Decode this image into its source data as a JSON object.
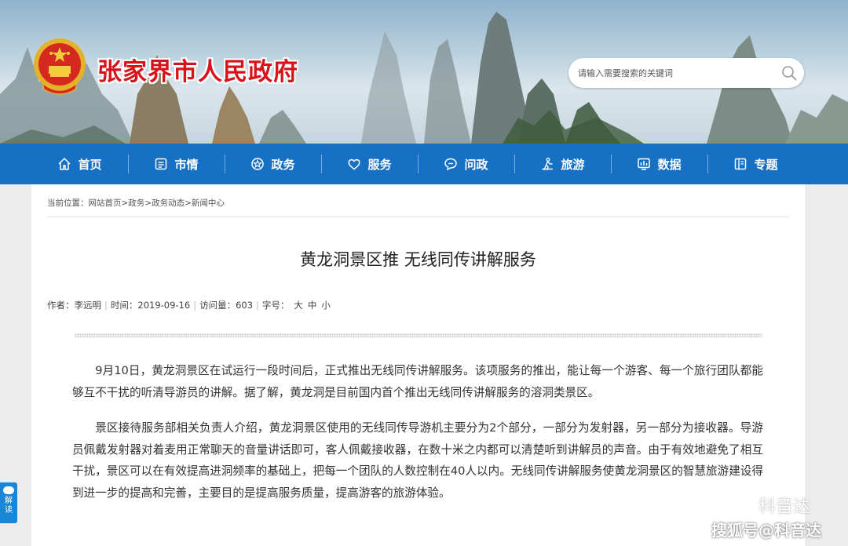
{
  "header": {
    "site_title": "张家界市人民政府",
    "search_placeholder": "请输入需要搜索的关键词"
  },
  "nav": {
    "items": [
      {
        "label": "首页",
        "icon": "home-icon"
      },
      {
        "label": "市情",
        "icon": "document-icon"
      },
      {
        "label": "政务",
        "icon": "badge-icon"
      },
      {
        "label": "服务",
        "icon": "heart-icon"
      },
      {
        "label": "问政",
        "icon": "chat-icon"
      },
      {
        "label": "旅游",
        "icon": "hiker-icon"
      },
      {
        "label": "数据",
        "icon": "chart-icon"
      },
      {
        "label": "专题",
        "icon": "book-icon"
      }
    ]
  },
  "breadcrumb": {
    "prefix": "当前位置：",
    "path": "网站首页>政务>政务动态>新闻中心"
  },
  "article": {
    "title": "黄龙洞景区推 无线同传讲解服务",
    "meta": {
      "author_label": "作者：",
      "author": "李远明",
      "time_label": "时间：",
      "time": "2019-09-16",
      "views_label": "访问量：",
      "views": "603",
      "fontsize_label": "字号：",
      "size_large": "大",
      "size_medium": "中",
      "size_small": "小"
    },
    "paragraphs": [
      "9月10日，黄龙洞景区在试运行一段时间后，正式推出无线同传讲解服务。该项服务的推出，能让每一个游客、每一个旅行团队都能够互不干扰的听清导游员的讲解。据了解，黄龙洞是目前国内首个推出无线同传讲解服务的溶洞类景区。",
      "景区接待服务部相关负责人介绍，黄龙洞景区使用的无线同传导游机主要分为2个部分，一部分为发射器，另一部分为接收器。导游员佩戴发射器对着麦用正常聊天的音量讲话即可，客人佩戴接收器，在数十米之内都可以清楚听到讲解员的声音。由于有效地避免了相互干扰，景区可以在有效提高进洞频率的基础上，把每一个团队的人数控制在40人以内。无线同传讲解服务使黄龙洞景区的智慧旅游建设得到进一步的提高和完善，主要目的是提高服务质量，提高游客的旅游体验。"
    ]
  },
  "side_tab": {
    "label_line1": "解",
    "label_line2": "读"
  },
  "watermark": {
    "brand": "科音达",
    "sohu": "搜狐号@科音达"
  },
  "colors": {
    "nav_bg": "#1670c4",
    "title_red": "#d7121b",
    "side_tab": "#1a86d6"
  }
}
